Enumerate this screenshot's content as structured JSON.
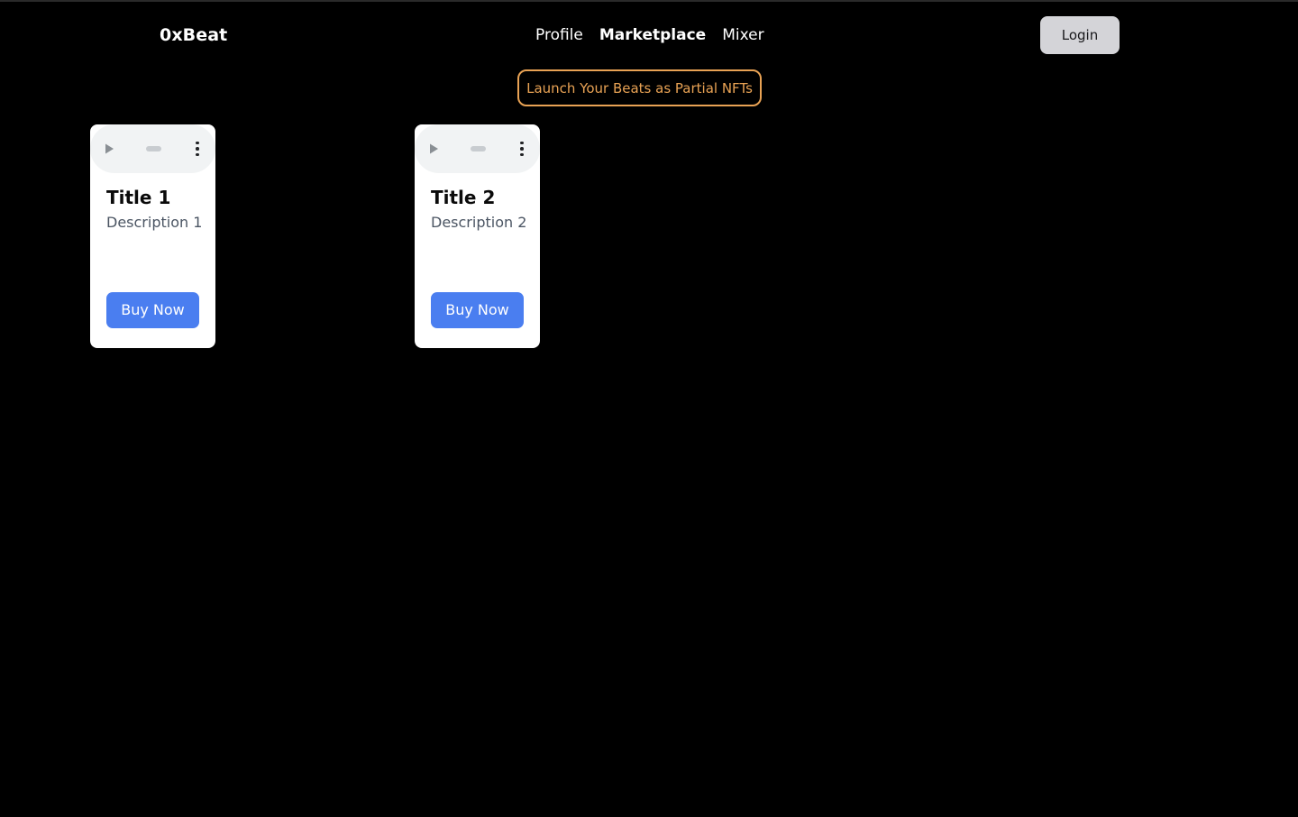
{
  "header": {
    "brand": "0xBeat",
    "nav_items": [
      {
        "label": "Profile",
        "active": false
      },
      {
        "label": "Marketplace",
        "active": true
      },
      {
        "label": "Mixer",
        "active": false
      }
    ],
    "login_label": "Login"
  },
  "promo": {
    "label": "Launch Your Beats as Partial NFTs",
    "border_color": "#e8a254",
    "text_color": "#e8a254"
  },
  "cards": [
    {
      "title": "Title 1",
      "description": "Description 1",
      "buy_label": "Buy Now",
      "player": {
        "play_icon": "play-icon",
        "menu_icon": "more-vertical-icon"
      }
    },
    {
      "title": "Title 2",
      "description": "Description 2",
      "buy_label": "Buy Now",
      "player": {
        "play_icon": "play-icon",
        "menu_icon": "more-vertical-icon"
      }
    }
  ],
  "theme": {
    "background": "#000000",
    "card_background": "#ffffff",
    "accent_blue": "#4a7ef0",
    "login_background": "#d4d4d8"
  }
}
